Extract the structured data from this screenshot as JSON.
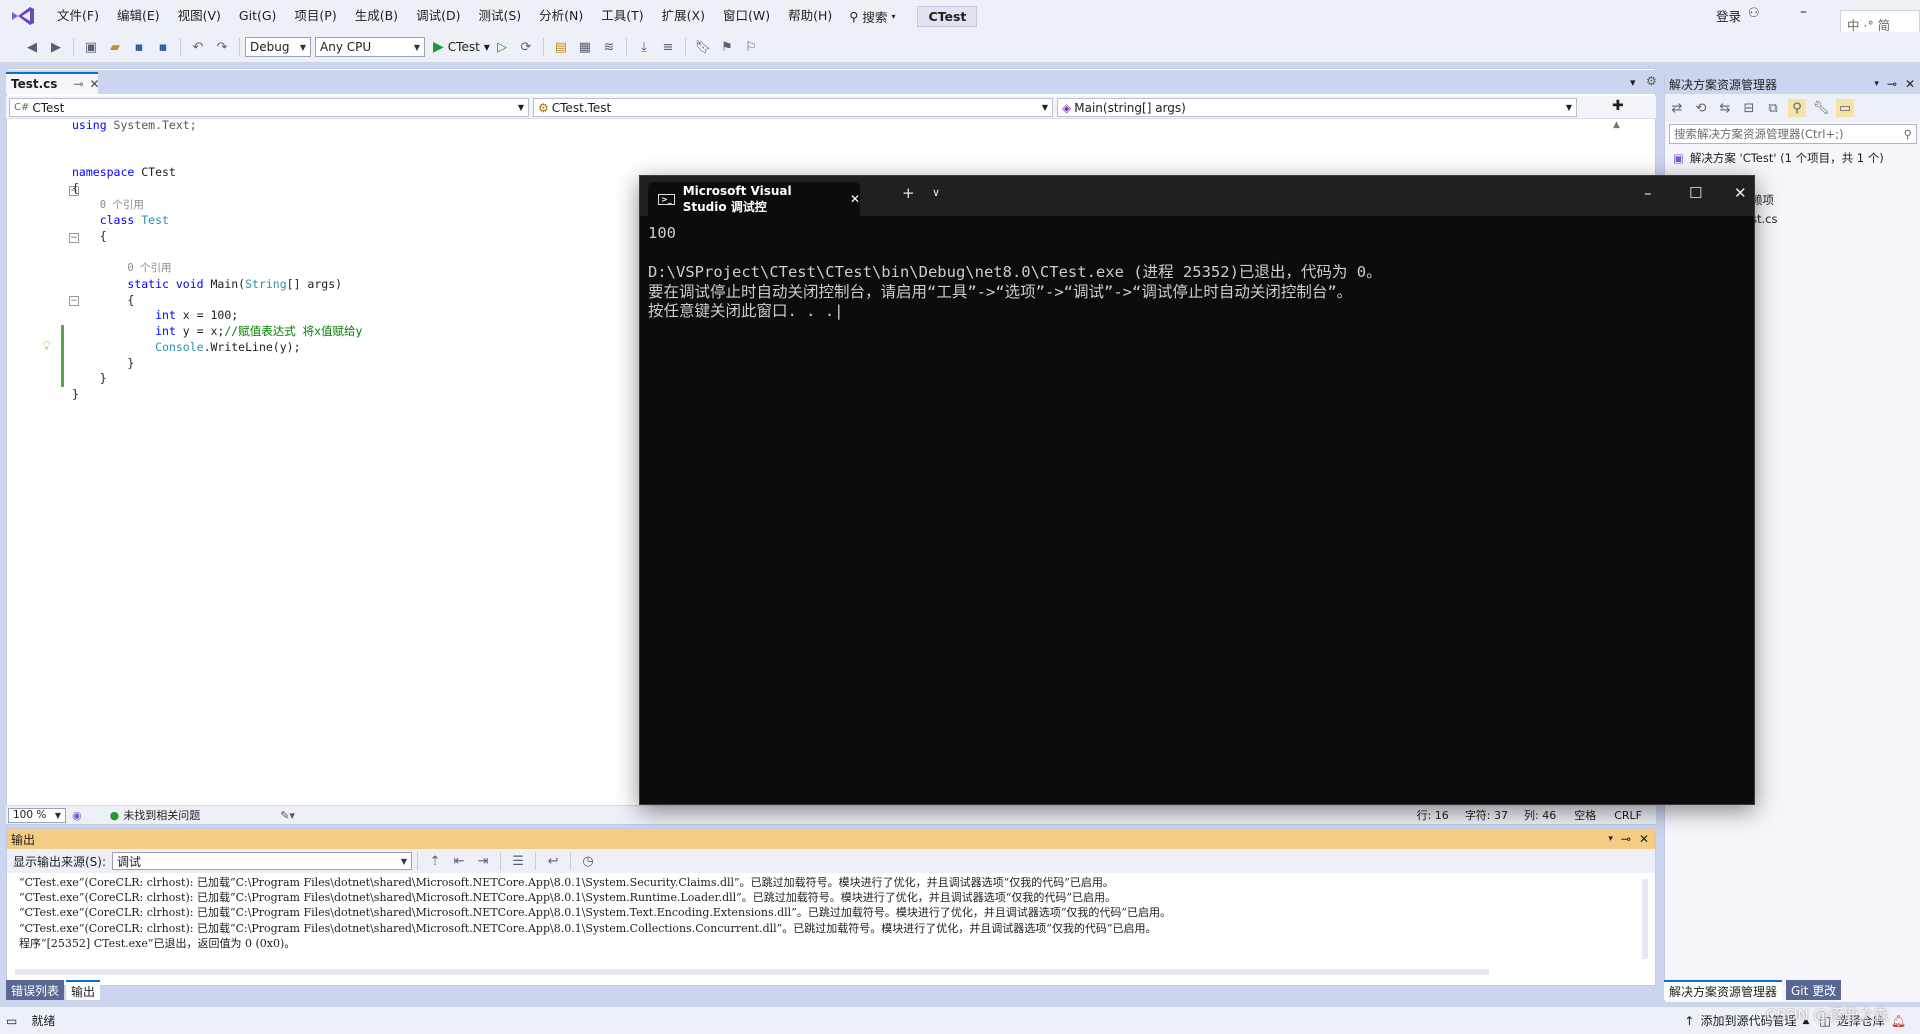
{
  "menu": {
    "items": [
      "文件(F)",
      "编辑(E)",
      "视图(V)",
      "Git(G)",
      "项目(P)",
      "生成(B)",
      "调试(D)",
      "测试(S)",
      "分析(N)",
      "工具(T)",
      "扩展(X)",
      "窗口(W)",
      "帮助(H)"
    ],
    "search": "搜索",
    "project": "CTest",
    "login": "登录",
    "ime": "中 ·° 简"
  },
  "toolbar": {
    "config": "Debug",
    "platform": "Any CPU",
    "run_label": "CTest"
  },
  "editor": {
    "tab": "Test.cs",
    "nav_left": "CTest",
    "nav_mid": "CTest.Test",
    "nav_right": "Main(string[] args)",
    "zoom": "100 %",
    "issues": "未找到相关问题",
    "line": "行: 16",
    "char": "字符: 37",
    "col": "列: 46",
    "ws": "空格",
    "eol": "CRLF"
  },
  "code": {
    "l1_kw": "using",
    "l1_rest": " System.Text;",
    "ns_kw": "namespace",
    "ns_name": " CTest",
    "open1": "{",
    "ref1": "0 个引用",
    "class_kw": "class",
    "class_name": " Test",
    "open2": "{",
    "ref2": "0 个引用",
    "m_static": "static",
    "m_void": " void",
    "m_name": " Main(",
    "m_type": "String",
    "m_rest": "[] args)",
    "open3": "{",
    "x_kw": "int",
    "x_rest": " x = 100;",
    "y_kw": "int",
    "y_rest": " y = x;",
    "y_comment": "//赋值表达式 将x值赋给y",
    "c_type": "Console",
    "c_rest": ".WriteLine(y);",
    "close3": "}",
    "close2": "}",
    "close1": "}"
  },
  "console": {
    "title": "Microsoft Visual Studio 调试控",
    "line1": "100",
    "line2": "D:\\VSProject\\CTest\\CTest\\bin\\Debug\\net8.0\\CTest.exe (进程 25352)已退出，代码为 0。",
    "line3": "要在调试停止时自动关闭控制台，请启用“工具”->“选项”->“调试”->“调试停止时自动关闭控制台”。",
    "line4": "按任意键关闭此窗口. . ."
  },
  "solution": {
    "title": "解决方案资源管理器",
    "search": "搜索解决方案资源管理器(Ctrl+;)",
    "root": "解决方案 'CTest' (1 个项目，共 1 个)",
    "item1": "赖项",
    "item2": "st.cs"
  },
  "output": {
    "title": "输出",
    "source_label": "显示输出来源(S):",
    "source": "调试",
    "lines": [
      "“CTest.exe”(CoreCLR: clrhost): 已加载“C:\\Program Files\\dotnet\\shared\\Microsoft.NETCore.App\\8.0.1\\System.Security.Claims.dll”。已跳过加载符号。模块进行了优化，并且调试器选项“仅我的代码”已启用。",
      "“CTest.exe”(CoreCLR: clrhost): 已加载“C:\\Program Files\\dotnet\\shared\\Microsoft.NETCore.App\\8.0.1\\System.Runtime.Loader.dll”。已跳过加载符号。模块进行了优化，并且调试器选项“仅我的代码”已启用。",
      "“CTest.exe”(CoreCLR: clrhost): 已加载“C:\\Program Files\\dotnet\\shared\\Microsoft.NETCore.App\\8.0.1\\System.Text.Encoding.Extensions.dll”。已跳过加载符号。模块进行了优化，并且调试器选项“仅我的代码”已启用。",
      "“CTest.exe”(CoreCLR: clrhost): 已加载“C:\\Program Files\\dotnet\\shared\\Microsoft.NETCore.App\\8.0.1\\System.Collections.Concurrent.dll”。已跳过加载符号。模块进行了优化，并且调试器选项“仅我的代码”已启用。",
      "程序“[25352] CTest.exe”已退出，返回值为 0 (0x0)。"
    ]
  },
  "bottom_tabs": {
    "errors": "错误列表",
    "output": "输出",
    "sol": "解决方案资源管理器",
    "git": "Git 更改"
  },
  "status": {
    "ready": "就绪",
    "add_src": "添加到源代码管理",
    "repo": "选择仓库",
    "watermark": "CSDN @逐鹿之森"
  },
  "colors": {
    "accent": "#0e70c0",
    "output_header": "#f5cc84",
    "console_bg": "#0c0c0c"
  }
}
